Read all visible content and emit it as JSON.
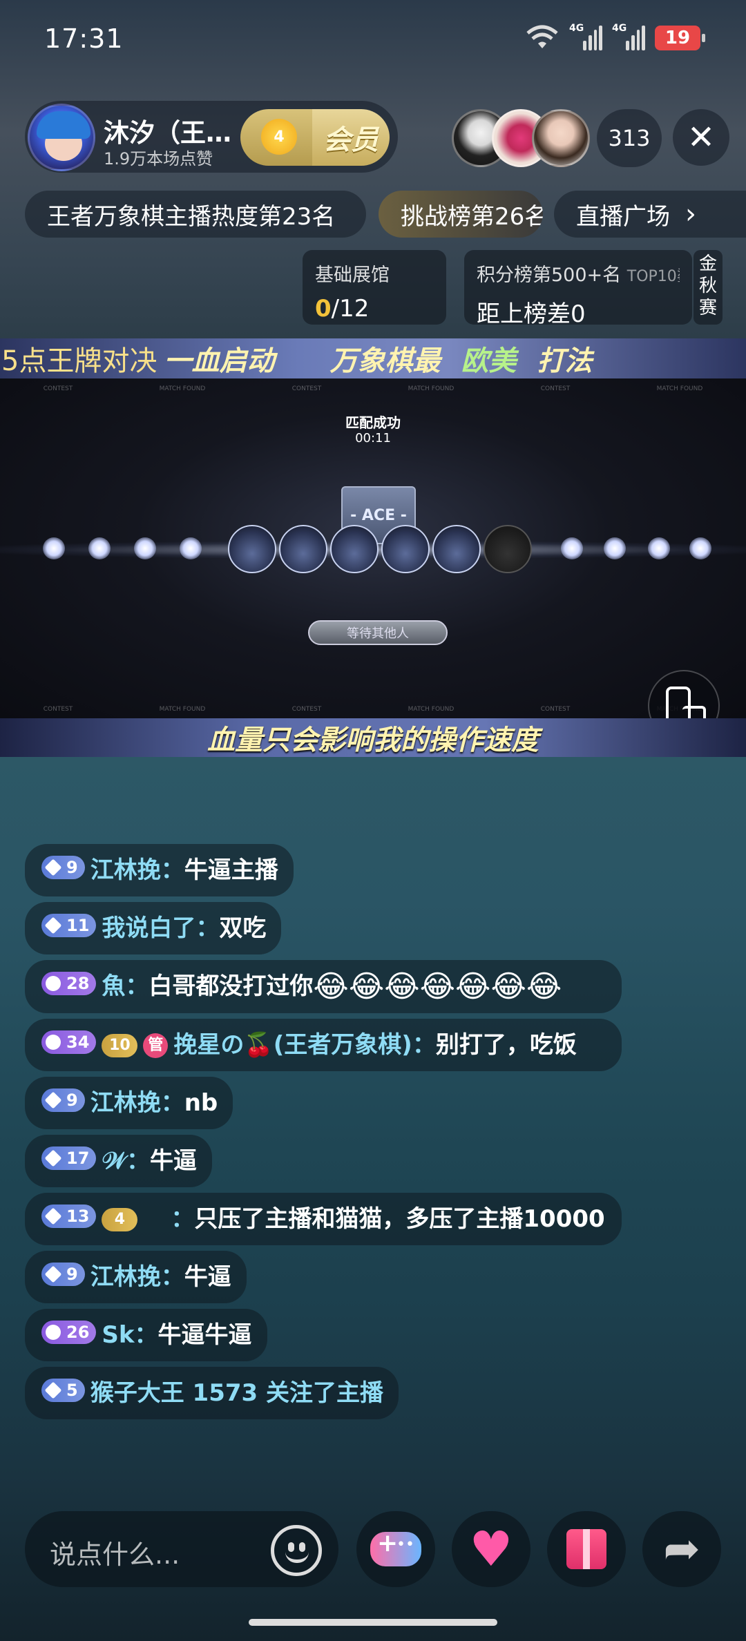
{
  "status_bar": {
    "time": "17:31",
    "net1": "4G",
    "net2": "4G",
    "battery": "19"
  },
  "host": {
    "name": "沐汐（王…",
    "likes": "1.9万本场点赞",
    "fan_level": "4",
    "vip_label": "会员"
  },
  "viewers": {
    "count": "313",
    "close_icon": "close-icon"
  },
  "tags": {
    "hot_rank": "王者万象棋主播热度第23名",
    "challenge": "挑战榜第26名",
    "plaza": "直播广场"
  },
  "cards": {
    "gallery_title": "基础展馆",
    "gallery_value": "0",
    "gallery_total": "/12",
    "rank_title": "积分榜第500+名",
    "rank_top": "TOP10鎏",
    "rank_diff": "距上榜差0",
    "side_text": "金秋赛"
  },
  "video": {
    "top_banner_a": "5点王牌对决",
    "top_banner_b": "一血启动",
    "top_banner_c": "万象棋最",
    "top_banner_d": "欧美",
    "top_banner_e": "打法",
    "match_title": "匹配成功",
    "match_time": "00:11",
    "ace_label": "- ACE -",
    "wait_label": "等待其他人",
    "bottom_banner": "血量只会影响我的操作速度",
    "bg_label_1": "CONTEST",
    "bg_label_2": "MATCH FOUND"
  },
  "chat": [
    {
      "level": "9",
      "level_color": "blue",
      "user": "江林挽：",
      "text": "牛逼主播"
    },
    {
      "level": "11",
      "level_color": "blue",
      "user": "我说白了：",
      "text": "双吃"
    },
    {
      "level": "28",
      "level_color": "purple",
      "user": "魚：",
      "text": "白哥都没打过你"
    },
    {
      "level": "34",
      "level_color": "purple",
      "fan": "10",
      "manager": "管",
      "user": "挽星の🍒(王者万象棋)：",
      "text": "别打了，吃饭"
    },
    {
      "level": "9",
      "level_color": "blue",
      "user": "江林挽：",
      "text": "nb"
    },
    {
      "level": "17",
      "level_color": "blue",
      "user": "𝒲：",
      "text": "牛逼"
    },
    {
      "level": "13",
      "level_color": "blue",
      "fan": "4",
      "user": "：",
      "text": "只压了主播和猫猫，多压了主播10000"
    },
    {
      "level": "9",
      "level_color": "blue",
      "user": "江林挽：",
      "text": "牛逼"
    },
    {
      "level": "26",
      "level_color": "purple",
      "user": "Sk：",
      "text": "牛逼牛逼"
    },
    {
      "level": "5",
      "level_color": "blue",
      "user": "猴子大王 1573 关注了主播",
      "text": ""
    }
  ],
  "input": {
    "placeholder": "说点什么..."
  },
  "icons": {
    "emoji": "laughing-crying-emoji",
    "face": "emoji-face-icon",
    "game": "gamepad-icon",
    "like": "heart-planet-icon",
    "gift": "gift-icon",
    "share": "share-arrow-icon"
  }
}
